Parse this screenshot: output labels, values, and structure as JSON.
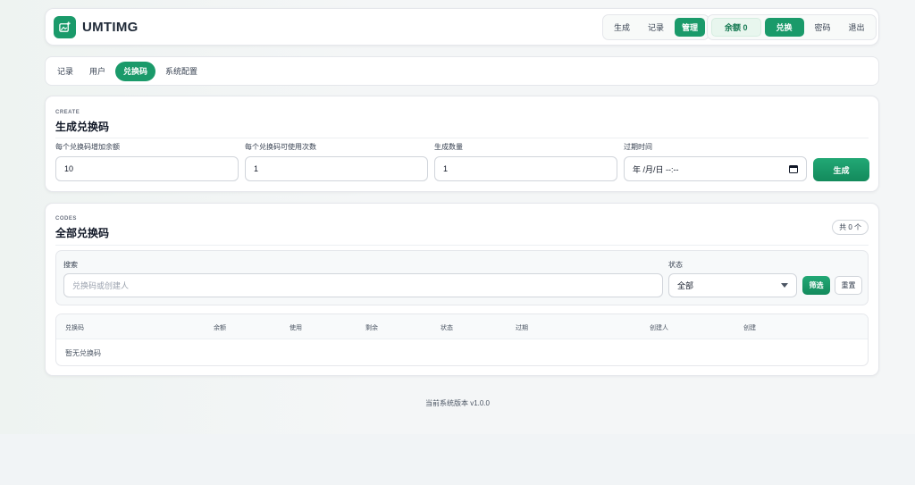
{
  "header": {
    "brand": "UMTIMG",
    "nav": [
      "生成",
      "记录",
      "管理"
    ],
    "balance": "余额 0",
    "exchange": "兑换",
    "password": "密码",
    "logout": "退出"
  },
  "tabs": [
    "记录",
    "用户",
    "兑换码",
    "系统配置"
  ],
  "create": {
    "eyebrow": "CREATE",
    "title": "生成兑换码",
    "fields": [
      {
        "label": "每个兑换码增加余额",
        "value": "10"
      },
      {
        "label": "每个兑换码可使用次数",
        "value": "1"
      },
      {
        "label": "生成数量",
        "value": "1"
      },
      {
        "label": "过期时间",
        "value": "年 /月/日 --:--"
      }
    ],
    "submit": "生成"
  },
  "codes": {
    "eyebrow": "CODES",
    "title": "全部兑换码",
    "count": "共 0 个",
    "search_label": "搜索",
    "search_placeholder": "兑换码或创建人",
    "status_label": "状态",
    "status_value": "全部",
    "filter": "筛选",
    "reset": "重置",
    "columns": [
      "兑换码",
      "余额",
      "使用",
      "剩余",
      "状态",
      "过期",
      "创建人",
      "创建"
    ],
    "empty": "暂无兑换码"
  },
  "footer": "当前系统版本 v1.0.0",
  "colors": {
    "accent": "#1a9a6a"
  }
}
